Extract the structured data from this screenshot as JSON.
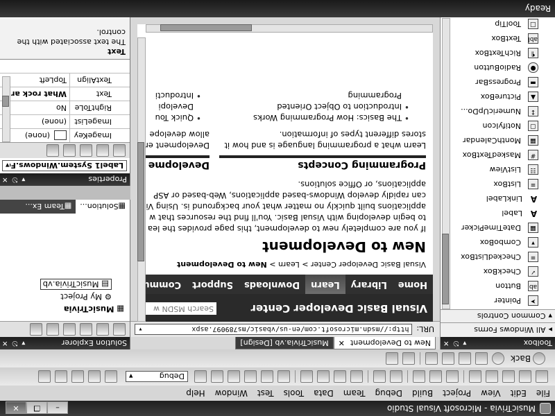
{
  "window": {
    "title": "MusicTrivia - Microsoft Visual Studio"
  },
  "menu": {
    "items": [
      "File",
      "Edit",
      "View",
      "Project",
      "Build",
      "Debug",
      "Team",
      "Data",
      "Tools",
      "Test",
      "Window",
      "Help"
    ]
  },
  "toolbar": {
    "config_value": "Debug"
  },
  "web_toolbar": {
    "back_label": "Back"
  },
  "toolbox": {
    "title": "Toolbox",
    "section_all": "All Windows Forms",
    "section_common": "Common Controls",
    "items": [
      {
        "label": "Pointer",
        "icon": "pointer-icon"
      },
      {
        "label": "Button",
        "icon": "button-icon"
      },
      {
        "label": "CheckBox",
        "icon": "checkbox-icon"
      },
      {
        "label": "CheckedListBox",
        "icon": "checked-listbox-icon"
      },
      {
        "label": "ComboBox",
        "icon": "combobox-icon"
      },
      {
        "label": "DateTimePicker",
        "icon": "calendar-icon"
      },
      {
        "label": "Label",
        "icon": "label-icon"
      },
      {
        "label": "LinkLabel",
        "icon": "link-icon"
      },
      {
        "label": "ListBox",
        "icon": "listbox-icon"
      },
      {
        "label": "ListView",
        "icon": "listview-icon"
      },
      {
        "label": "MaskedTextBox",
        "icon": "masked-textbox-icon"
      },
      {
        "label": "MonthCalendar",
        "icon": "calendar-icon"
      },
      {
        "label": "NotifyIcon",
        "icon": "notify-icon"
      },
      {
        "label": "NumericUpDo...",
        "icon": "spinner-icon"
      },
      {
        "label": "PictureBox",
        "icon": "picture-icon"
      },
      {
        "label": "ProgressBar",
        "icon": "progress-icon"
      },
      {
        "label": "RadioButton",
        "icon": "radio-icon"
      },
      {
        "label": "RichTextBox",
        "icon": "richtext-icon"
      },
      {
        "label": "TextBox",
        "icon": "textbox-icon"
      },
      {
        "label": "ToolTip",
        "icon": "tooltip-icon"
      }
    ]
  },
  "document": {
    "tabs": [
      {
        "label": "New to Development"
      },
      {
        "label": "MusicTrivia.vb [Design]"
      }
    ],
    "url_label": "URL:",
    "url": "http://msdn.microsoft.com/en-us/vbasic/ms789097.aspx",
    "site_title": "Visual Basic Developer Center",
    "search_placeholder": "Search MSDN w",
    "nav": [
      "Home",
      "Library",
      "Learn",
      "Downloads",
      "Support",
      "Community"
    ],
    "breadcrumb_1": "Visual Basic Developer Center",
    "breadcrumb_sep": ">",
    "breadcrumb_2": "Learn",
    "breadcrumb_current": "New to Development",
    "heading": "New to Development",
    "intro_lines": [
      "If you are completely new to development, this page provides the lea",
      "to begin developing with Visual Basic. You'll find the resources that w",
      "applications built quickly no matter what your background is. Using Vi",
      "can rapidly develop Windows-based applications, Web-based or ASP",
      "applications, or Office solutions."
    ],
    "col1_heading": "Programming Concepts",
    "col1_lines": [
      "Learn what a programming language is and how it",
      "stores different types of information."
    ],
    "col1_bullets": [
      "The Basics: How Programming Works",
      "Introduction to Object Oriented",
      "Programming"
    ],
    "col2_heading": "Developme",
    "col2_lines": [
      "Development er",
      "allow develope"
    ],
    "col2_bullets": [
      "Quick Tou",
      "Developi",
      "Introducti"
    ]
  },
  "solution": {
    "title": "Solution Explorer",
    "tree_root": "MusicTrivia",
    "tree_items": [
      "My Project",
      "MusicTrivia.vb"
    ],
    "tab_solution": "Solution...",
    "tab_team": "Team Ex..."
  },
  "properties": {
    "title": "Properties",
    "object": "Label1  System.Windows.For",
    "rows": [
      {
        "name": "ImageKey",
        "value": "(none)"
      },
      {
        "name": "ImageList",
        "value": "(none)"
      },
      {
        "name": "RightToLe",
        "value": "No"
      },
      {
        "name": "Text",
        "value": "What rock ar"
      },
      {
        "name": "TextAlign",
        "value": "TopLeft"
      }
    ],
    "desc_title": "Text",
    "desc_line1": "The text associated with the",
    "desc_line2": "control."
  },
  "status": {
    "text": "Ready"
  }
}
